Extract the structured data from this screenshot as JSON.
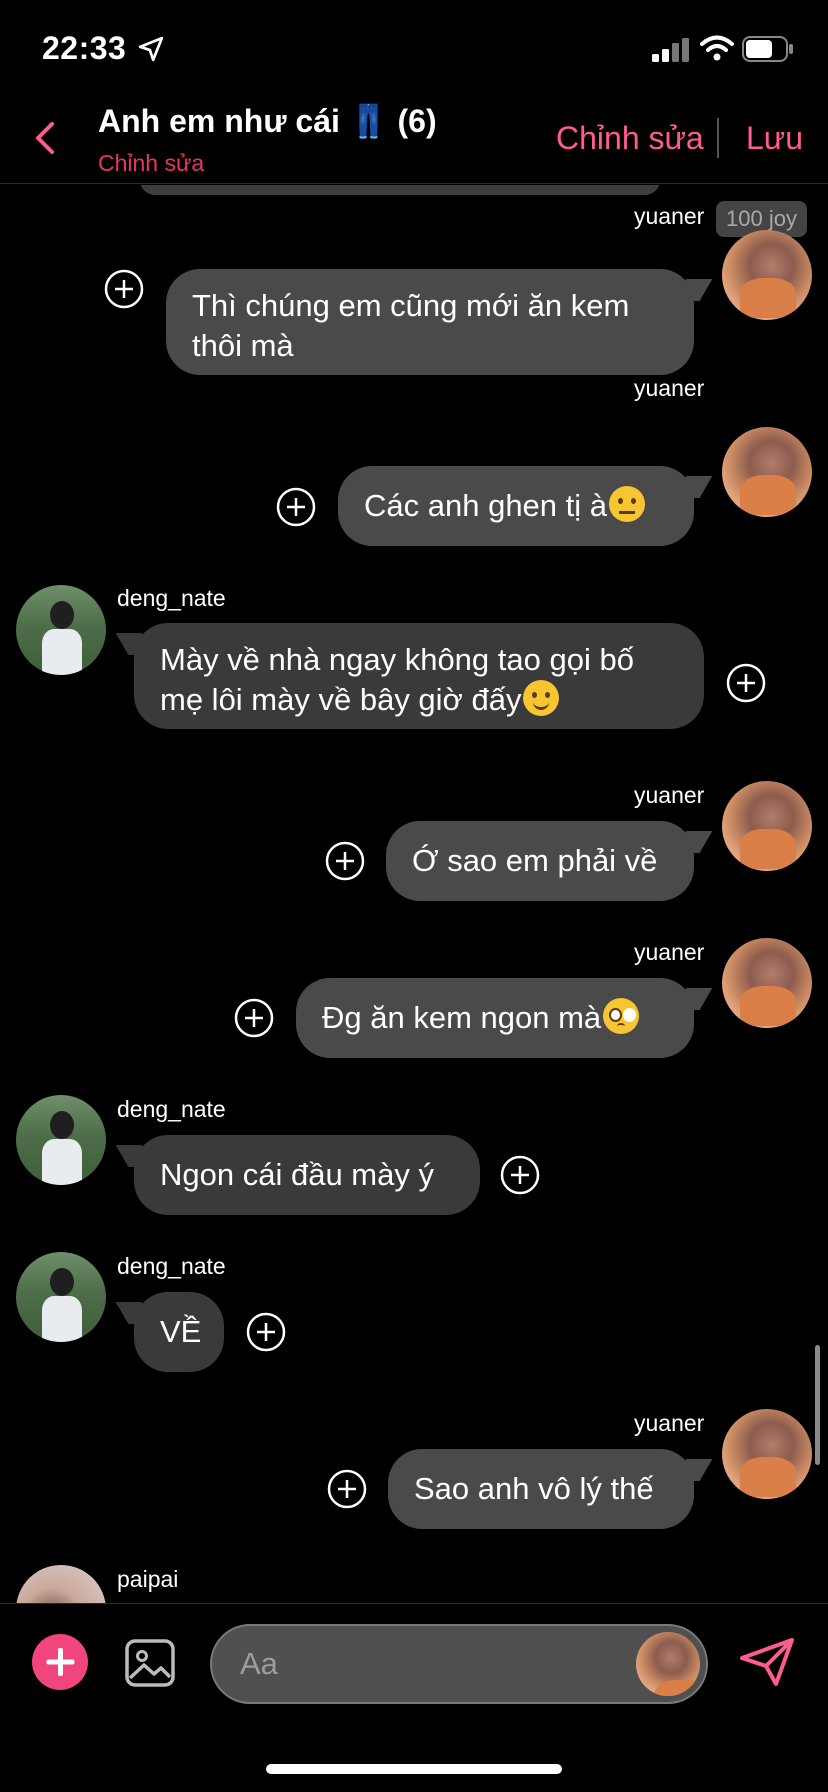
{
  "status_bar": {
    "time": "22:33"
  },
  "header": {
    "title": "Anh em như cái 👖 (6)",
    "subtitle": "Chỉnh sửa",
    "edit_label": "Chỉnh sửa",
    "save_label": "Lưu"
  },
  "chat": {
    "joy_badge": "100 joy",
    "messages": [
      {
        "sender": "yuaner",
        "text_lines": [
          "Thì chúng em cũng mới ăn kem",
          "thôi mà"
        ],
        "outgoing": true
      },
      {
        "sender": "yuaner",
        "text": "Các anh ghen tị à",
        "emoji": "face-with-raised-eyebrow",
        "outgoing": true
      },
      {
        "sender": "deng_nate",
        "text_lines": [
          "Mày về nhà ngay không tao gọi bố",
          "mẹ lôi mày về bây giờ đấy"
        ],
        "emoji": "slightly-smiling-face",
        "outgoing": false
      },
      {
        "sender": "yuaner",
        "text": "Ớ sao em phải về",
        "outgoing": true
      },
      {
        "sender": "yuaner",
        "text": "Đg ăn kem ngon mà",
        "emoji": "pleading-face",
        "outgoing": true
      },
      {
        "sender": "deng_nate",
        "text": "Ngon cái đầu mày ý",
        "outgoing": false
      },
      {
        "sender": "deng_nate",
        "text": "VỀ",
        "outgoing": false
      },
      {
        "sender": "yuaner",
        "text": "Sao anh vô lý thế",
        "outgoing": true
      },
      {
        "sender": "paipai",
        "outgoing": false
      }
    ]
  },
  "composer": {
    "placeholder": "Aa"
  },
  "colors": {
    "accent": "#ff5c8d",
    "add_button": "#f0457d",
    "outgoing_bubble": "#4a4a4a",
    "incoming_bubble": "#3a3a3a"
  },
  "icons": [
    "location-arrow-icon",
    "signal-icon",
    "wifi-icon",
    "battery-icon",
    "back-chevron-icon",
    "add-reaction-icon",
    "plus-icon",
    "gallery-icon",
    "send-icon"
  ]
}
